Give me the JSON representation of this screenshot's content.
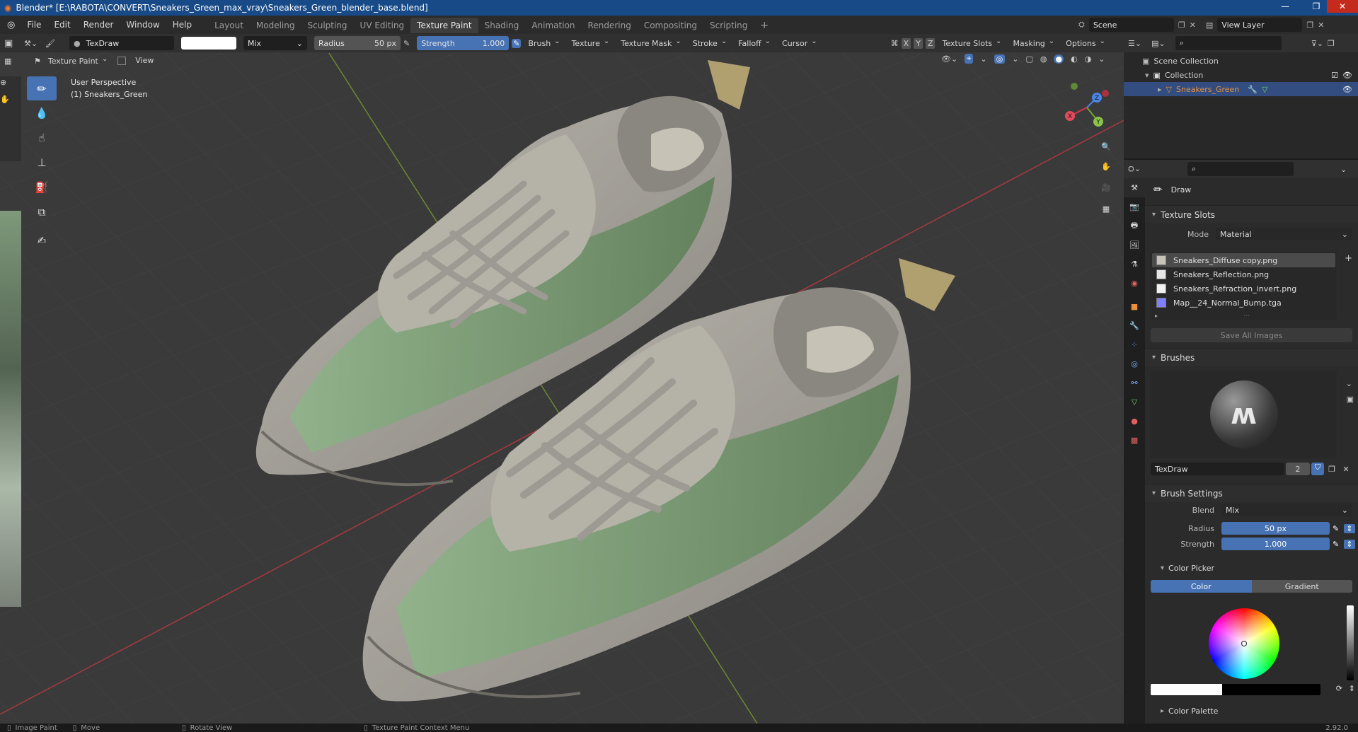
{
  "window": {
    "title": "Blender* [E:\\RABOTA\\CONVERT\\Sneakers_Green_max_vray\\Sneakers_Green_blender_base.blend]"
  },
  "menu": [
    "File",
    "Edit",
    "Render",
    "Window",
    "Help"
  ],
  "workspaces": [
    {
      "label": "Layout",
      "active": false
    },
    {
      "label": "Modeling",
      "active": false
    },
    {
      "label": "Sculpting",
      "active": false
    },
    {
      "label": "UV Editing",
      "active": false
    },
    {
      "label": "Texture Paint",
      "active": true
    },
    {
      "label": "Shading",
      "active": false
    },
    {
      "label": "Animation",
      "active": false
    },
    {
      "label": "Rendering",
      "active": false
    },
    {
      "label": "Compositing",
      "active": false
    },
    {
      "label": "Scripting",
      "active": false
    }
  ],
  "scene": {
    "name": "Scene",
    "view_layer": "View Layer"
  },
  "toolheader": {
    "brush_name": "TexDraw",
    "blend": "Mix",
    "radius_label": "Radius",
    "radius_value": "50 px",
    "strength_label": "Strength",
    "strength_value": "1.000",
    "dropdowns": [
      "Brush",
      "Texture",
      "Texture Mask",
      "Stroke",
      "Falloff",
      "Cursor"
    ],
    "axes": [
      "X",
      "Y",
      "Z"
    ],
    "right_dropdowns": [
      "Texture Slots",
      "Masking",
      "Options"
    ]
  },
  "viewheader": {
    "mode": "Texture Paint",
    "view": "View"
  },
  "viewport": {
    "perspective": "User Perspective",
    "object_label": "(1) Sneakers_Green",
    "gizmo": {
      "x": "X",
      "y": "Y",
      "z": "Z"
    }
  },
  "outliner": {
    "scene_collection": "Scene Collection",
    "collection": "Collection",
    "object": "Sneakers_Green"
  },
  "properties": {
    "tool_name": "Draw",
    "texture_slots_title": "Texture Slots",
    "mode_label": "Mode",
    "mode_value": "Material",
    "slots": [
      {
        "name": "Sneakers_Diffuse copy.png",
        "selected": true,
        "color": "#c8c3b8"
      },
      {
        "name": "Sneakers_Reflection.png",
        "selected": false,
        "color": "#e6e6e6"
      },
      {
        "name": "Sneakers_Refraction_invert.png",
        "selected": false,
        "color": "#f2f2f2"
      },
      {
        "name": "Map__24_Normal_Bump.tga",
        "selected": false,
        "color": "#8080ff"
      }
    ],
    "save_all": "Save All Images",
    "brushes_title": "Brushes",
    "brush_name": "TexDraw",
    "brush_users": "2",
    "brush_settings_title": "Brush Settings",
    "blend_label": "Blend",
    "blend_value": "Mix",
    "radius_label": "Radius",
    "radius_value": "50 px",
    "strength_label": "Strength",
    "strength_value": "1.000",
    "color_picker_title": "Color Picker",
    "color_tab": "Color",
    "gradient_tab": "Gradient",
    "color_palette_title": "Color Palette"
  },
  "statusbar": {
    "image_paint": "Image Paint",
    "move": "Move",
    "rotate": "Rotate View",
    "context": "Texture Paint Context Menu",
    "version": "2.92.0"
  },
  "colors": {
    "accent": "#4772b3",
    "title_bar": "#174a86",
    "active_object": "#e8913a",
    "viewport_bg": "#3a3a3a"
  }
}
